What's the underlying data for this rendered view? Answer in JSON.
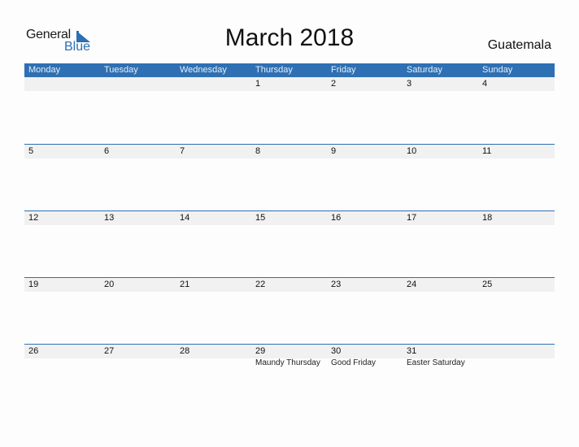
{
  "logo": {
    "line1": "General",
    "line2": "Blue",
    "icon": "triangle-flag-icon"
  },
  "title": "March 2018",
  "country": "Guatemala",
  "colors": {
    "accent": "#2e70b3",
    "band": "#f1f1f1",
    "logo_blue": "#2c6fb2"
  },
  "weekdays": [
    "Monday",
    "Tuesday",
    "Wednesday",
    "Thursday",
    "Friday",
    "Saturday",
    "Sunday"
  ],
  "weeks": [
    {
      "days": [
        {
          "num": "",
          "holiday": ""
        },
        {
          "num": "",
          "holiday": ""
        },
        {
          "num": "",
          "holiday": ""
        },
        {
          "num": "1",
          "holiday": ""
        },
        {
          "num": "2",
          "holiday": ""
        },
        {
          "num": "3",
          "holiday": ""
        },
        {
          "num": "4",
          "holiday": ""
        }
      ]
    },
    {
      "days": [
        {
          "num": "5",
          "holiday": ""
        },
        {
          "num": "6",
          "holiday": ""
        },
        {
          "num": "7",
          "holiday": ""
        },
        {
          "num": "8",
          "holiday": ""
        },
        {
          "num": "9",
          "holiday": ""
        },
        {
          "num": "10",
          "holiday": ""
        },
        {
          "num": "11",
          "holiday": ""
        }
      ]
    },
    {
      "days": [
        {
          "num": "12",
          "holiday": ""
        },
        {
          "num": "13",
          "holiday": ""
        },
        {
          "num": "14",
          "holiday": ""
        },
        {
          "num": "15",
          "holiday": ""
        },
        {
          "num": "16",
          "holiday": ""
        },
        {
          "num": "17",
          "holiday": ""
        },
        {
          "num": "18",
          "holiday": ""
        }
      ]
    },
    {
      "days": [
        {
          "num": "19",
          "holiday": ""
        },
        {
          "num": "20",
          "holiday": ""
        },
        {
          "num": "21",
          "holiday": ""
        },
        {
          "num": "22",
          "holiday": ""
        },
        {
          "num": "23",
          "holiday": ""
        },
        {
          "num": "24",
          "holiday": ""
        },
        {
          "num": "25",
          "holiday": ""
        }
      ]
    },
    {
      "days": [
        {
          "num": "26",
          "holiday": ""
        },
        {
          "num": "27",
          "holiday": ""
        },
        {
          "num": "28",
          "holiday": ""
        },
        {
          "num": "29",
          "holiday": "Maundy Thursday"
        },
        {
          "num": "30",
          "holiday": "Good Friday"
        },
        {
          "num": "31",
          "holiday": "Easter Saturday"
        },
        {
          "num": "",
          "holiday": ""
        }
      ]
    }
  ]
}
